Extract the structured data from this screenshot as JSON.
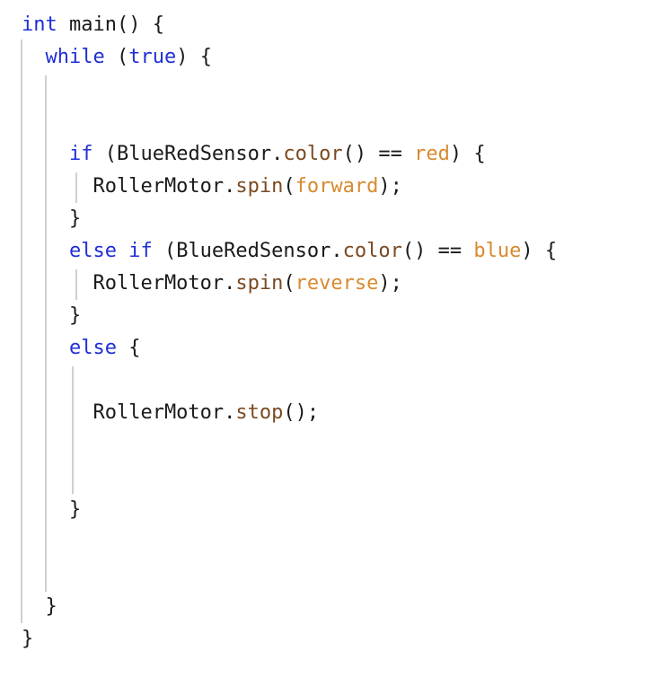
{
  "code": {
    "indent": "  ",
    "lines": [
      {
        "tokens": [
          {
            "t": "int",
            "c": "kw"
          },
          {
            "t": " main() {",
            "c": "plain"
          }
        ]
      },
      {
        "tokens": [
          {
            "t": "  ",
            "c": "plain"
          },
          {
            "t": "while",
            "c": "kw"
          },
          {
            "t": " (",
            "c": "plain"
          },
          {
            "t": "true",
            "c": "kw"
          },
          {
            "t": ") {",
            "c": "plain"
          }
        ]
      },
      {
        "tokens": []
      },
      {
        "tokens": []
      },
      {
        "tokens": [
          {
            "t": "    ",
            "c": "plain"
          },
          {
            "t": "if",
            "c": "kw"
          },
          {
            "t": " (BlueRedSensor.",
            "c": "plain"
          },
          {
            "t": "color",
            "c": "fn"
          },
          {
            "t": "() == ",
            "c": "plain"
          },
          {
            "t": "red",
            "c": "const"
          },
          {
            "t": ") {",
            "c": "plain"
          }
        ]
      },
      {
        "tokens": [
          {
            "t": "      RollerMotor.",
            "c": "plain"
          },
          {
            "t": "spin",
            "c": "fn"
          },
          {
            "t": "(",
            "c": "plain"
          },
          {
            "t": "forward",
            "c": "const"
          },
          {
            "t": ");",
            "c": "plain"
          }
        ]
      },
      {
        "tokens": [
          {
            "t": "    }",
            "c": "plain"
          }
        ]
      },
      {
        "tokens": [
          {
            "t": "    ",
            "c": "plain"
          },
          {
            "t": "else if",
            "c": "kw"
          },
          {
            "t": " (BlueRedSensor.",
            "c": "plain"
          },
          {
            "t": "color",
            "c": "fn"
          },
          {
            "t": "() == ",
            "c": "plain"
          },
          {
            "t": "blue",
            "c": "const"
          },
          {
            "t": ") {",
            "c": "plain"
          }
        ]
      },
      {
        "tokens": [
          {
            "t": "      RollerMotor.",
            "c": "plain"
          },
          {
            "t": "spin",
            "c": "fn"
          },
          {
            "t": "(",
            "c": "plain"
          },
          {
            "t": "reverse",
            "c": "const"
          },
          {
            "t": ");",
            "c": "plain"
          }
        ]
      },
      {
        "tokens": [
          {
            "t": "    }",
            "c": "plain"
          }
        ]
      },
      {
        "tokens": [
          {
            "t": "    ",
            "c": "plain"
          },
          {
            "t": "else",
            "c": "kw"
          },
          {
            "t": " {",
            "c": "plain"
          }
        ]
      },
      {
        "tokens": []
      },
      {
        "tokens": [
          {
            "t": "      RollerMotor.",
            "c": "plain"
          },
          {
            "t": "stop",
            "c": "fn"
          },
          {
            "t": "();",
            "c": "plain"
          }
        ]
      },
      {
        "tokens": []
      },
      {
        "tokens": []
      },
      {
        "tokens": [
          {
            "t": "    }",
            "c": "plain"
          }
        ]
      },
      {
        "tokens": []
      },
      {
        "tokens": []
      },
      {
        "tokens": [
          {
            "t": "  }",
            "c": "plain"
          }
        ]
      },
      {
        "tokens": [
          {
            "t": "}",
            "c": "plain"
          }
        ]
      }
    ]
  },
  "colors": {
    "keyword": "#1f2fd6",
    "function": "#7a4a22",
    "constant": "#d88a2e",
    "text": "#1a1a1a",
    "indent_guide": "#cfcfcf",
    "background": "#ffffff"
  }
}
